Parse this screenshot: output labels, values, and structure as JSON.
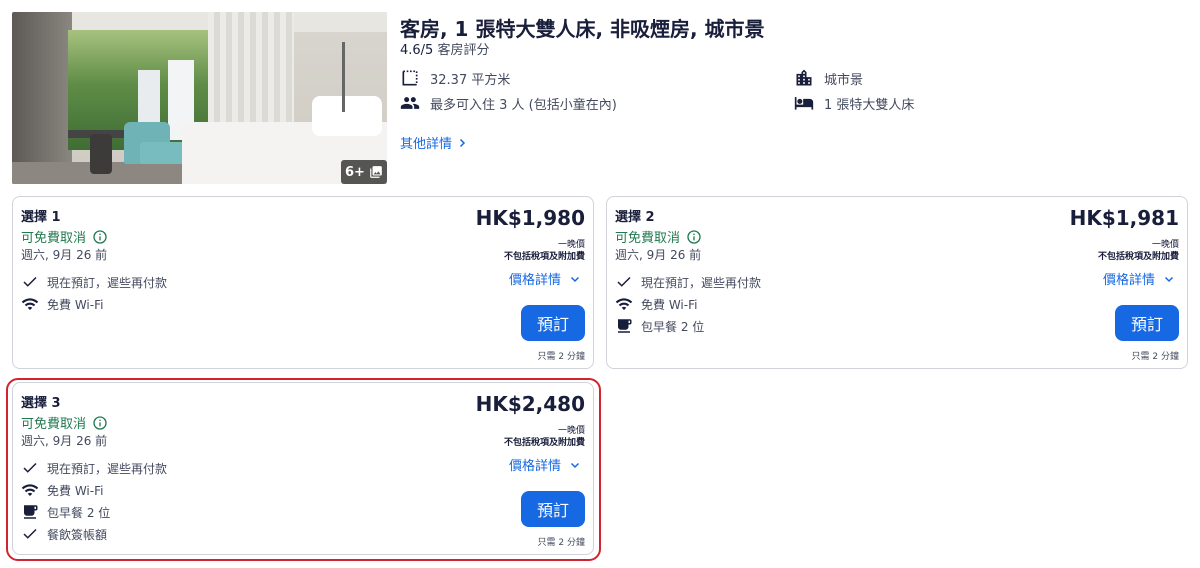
{
  "room": {
    "title": "客房, 1 張特大雙人床, 非吸煙房, 城市景",
    "rating_score": "4.6/5",
    "rating_label": "客房評分",
    "photo_count": "6+",
    "amenities": {
      "size": "32.37 平方米",
      "occupancy": "最多可入住 3 人 (包括小童在內)",
      "view": "城市景",
      "bed": "1 張特大雙人床"
    },
    "more_details": "其他詳情"
  },
  "options": [
    {
      "title": "選擇 1",
      "cancel": "可免費取消",
      "cancel_date": "週六, 9月 26 前",
      "features": [
        "現在預訂，遲些再付款",
        "免費 Wi-Fi"
      ],
      "price": "HK$1,980",
      "per_night": "一晚價",
      "tax_note": "不包括稅項及附加費",
      "price_details": "價格詳情",
      "book": "預訂",
      "time_note": "只需 2 分鐘"
    },
    {
      "title": "選擇 2",
      "cancel": "可免費取消",
      "cancel_date": "週六, 9月 26 前",
      "features": [
        "現在預訂，遲些再付款",
        "免費 Wi-Fi",
        "包早餐 2 位"
      ],
      "price": "HK$1,981",
      "per_night": "一晚價",
      "tax_note": "不包括稅項及附加費",
      "price_details": "價格詳情",
      "book": "預訂",
      "time_note": "只需 2 分鐘"
    },
    {
      "title": "選擇 3",
      "cancel": "可免費取消",
      "cancel_date": "週六, 9月 26 前",
      "features": [
        "現在預訂，遲些再付款",
        "免費 Wi-Fi",
        "包早餐 2 位",
        "餐飲簽帳額"
      ],
      "price": "HK$2,480",
      "per_night": "一晚價",
      "tax_note": "不包括稅項及附加費",
      "price_details": "價格詳情",
      "book": "預訂",
      "time_note": "只需 2 分鐘"
    }
  ],
  "colors": {
    "accent": "#1668e3",
    "success": "#227950",
    "text": "#191e3b",
    "highlight": "#d2232f"
  }
}
